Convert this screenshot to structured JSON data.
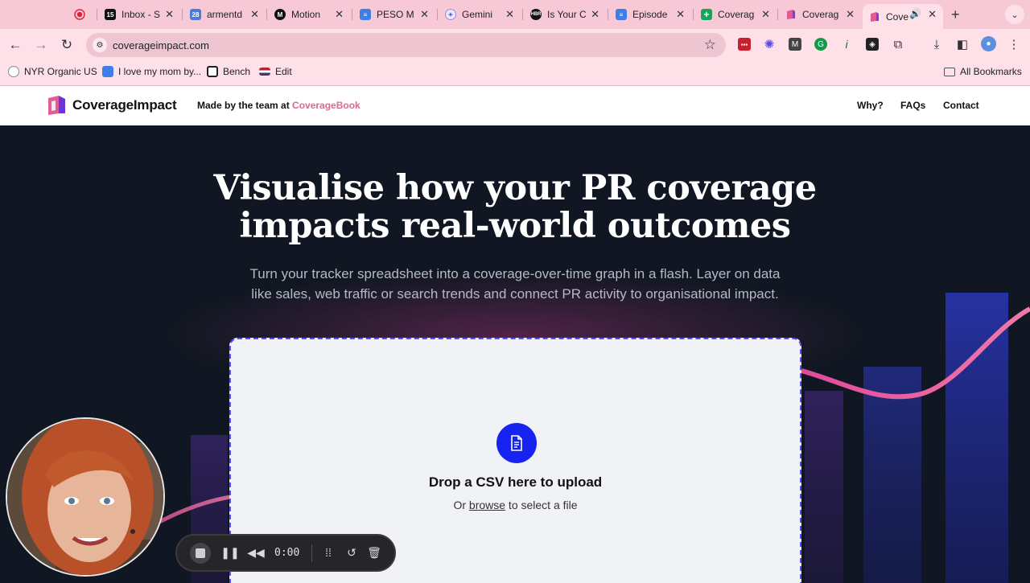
{
  "browser": {
    "tabs": [
      {
        "title": "",
        "favicon": "record-icon",
        "color": "#e0243b"
      },
      {
        "title": "Inbox - S",
        "favicon": "calendar-15-icon",
        "color": "#111111"
      },
      {
        "title": "armentd",
        "favicon": "calendar-28-icon",
        "color": "#4a7bd8"
      },
      {
        "title": "Motion",
        "favicon": "motion-icon",
        "color": "#111111"
      },
      {
        "title": "PESO M",
        "favicon": "docs-icon",
        "color": "#3f7ee8"
      },
      {
        "title": "Gemini",
        "favicon": "gemini-icon",
        "color": "#7a6ad8"
      },
      {
        "title": "Is Your C",
        "favicon": "hbr-icon",
        "color": "#111111"
      },
      {
        "title": "Episode",
        "favicon": "docs-icon",
        "color": "#3f7ee8"
      },
      {
        "title": "Coverag",
        "favicon": "sheets-plus-icon",
        "color": "#1aa35a"
      },
      {
        "title": "Coverag",
        "favicon": "coverageimpact-icon",
        "color": "#d2418a"
      },
      {
        "title": "Cove",
        "favicon": "coverageimpact-icon",
        "color": "#d2418a"
      }
    ],
    "url": "coverageimpact.com",
    "bookmarks": [
      {
        "label": "NYR Organic US",
        "icon": "globe-icon"
      },
      {
        "label": "I love my mom by...",
        "icon": "docs-icon"
      },
      {
        "label": "Bench",
        "icon": "bench-icon"
      },
      {
        "label": "Edit",
        "icon": "flag-icon"
      }
    ],
    "all_bookmarks": "All Bookmarks"
  },
  "site": {
    "logo_text": "CoverageImpact",
    "made_by_prefix": "Made by the team at ",
    "made_by_brand": "CoverageBook",
    "nav": [
      "Why?",
      "FAQs",
      "Contact"
    ]
  },
  "hero": {
    "headline_line1": "Visualise how your PR coverage",
    "headline_line2": "impacts real-world outcomes",
    "subtitle_line1": "Turn your tracker spreadsheet into a coverage-over-time graph in a flash. Layer on data",
    "subtitle_line2": "like sales, web traffic or search trends and connect PR activity to organisational impact."
  },
  "upload": {
    "title": "Drop a CSV here to upload",
    "sub_prefix": "Or ",
    "sub_link": "browse",
    "sub_suffix": " to select a file"
  },
  "recorder": {
    "time": "0:00"
  },
  "colors": {
    "accent": "#1723f0",
    "brand_pink": "#d86a8f",
    "hero_bg": "#111722",
    "tab_strip": "#f7c9d6"
  }
}
